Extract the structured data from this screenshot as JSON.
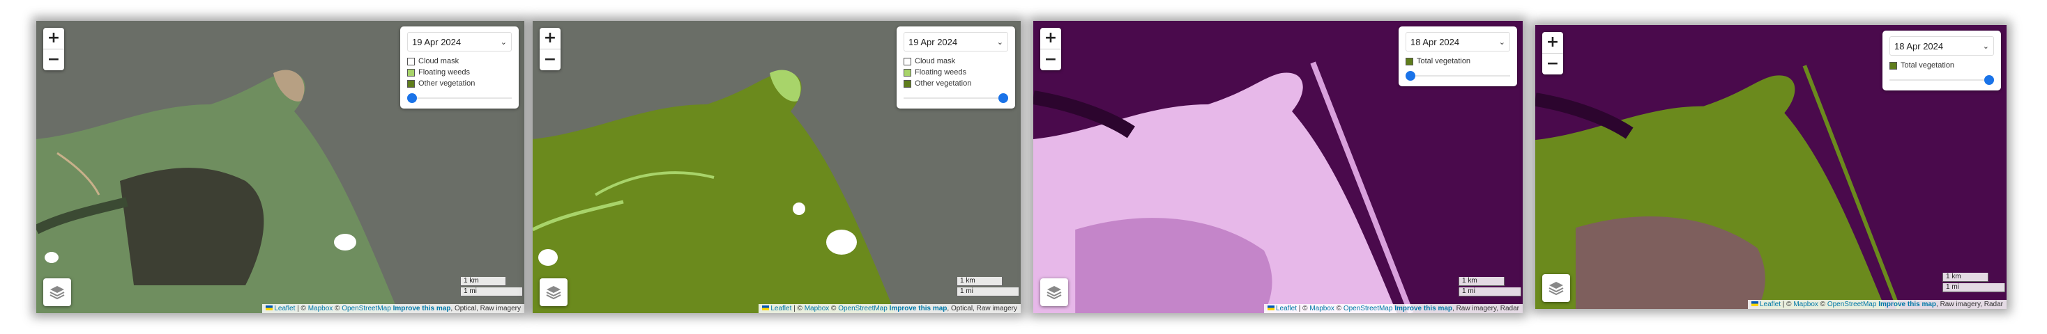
{
  "zoom": {
    "in_label": "+",
    "out_label": "−"
  },
  "attribution": {
    "leaflet": "Leaflet",
    "sep1": " | © ",
    "mapbox": "Mapbox",
    "sep2": " © ",
    "osm": "OpenStreetMap",
    "improve": "Improve this map"
  },
  "scale": {
    "km": "1 km",
    "mi": "1 mi"
  },
  "panels": [
    {
      "date": "19 Apr 2024",
      "slider_value": 0,
      "suffix": ", Optical, Raw imagery",
      "legend": [
        {
          "label": "Cloud mask",
          "color": "#ffffff"
        },
        {
          "label": "Floating weeds",
          "color": "#a8d46a"
        },
        {
          "label": "Other vegetation",
          "color": "#5f7d1c"
        }
      ]
    },
    {
      "date": "19 Apr 2024",
      "slider_value": 1,
      "suffix": ", Optical, Raw imagery",
      "legend": [
        {
          "label": "Cloud mask",
          "color": "#ffffff"
        },
        {
          "label": "Floating weeds",
          "color": "#a8d46a"
        },
        {
          "label": "Other vegetation",
          "color": "#5f7d1c"
        }
      ]
    },
    {
      "date": "18 Apr 2024",
      "slider_value": 0,
      "suffix": ", Raw imagery, Radar",
      "legend": [
        {
          "label": "Total vegetation",
          "color": "#5f7d1c"
        }
      ]
    },
    {
      "date": "18 Apr 2024",
      "slider_value": 1,
      "suffix": ", Raw imagery, Radar",
      "legend": [
        {
          "label": "Total vegetation",
          "color": "#5f7d1c"
        }
      ]
    }
  ],
  "colors": {
    "water_optical": "#6a6e67",
    "land_optical": "#6f8e5f",
    "veg": "#6b8a1d",
    "radar_bg": "#4a0a4c",
    "radar_land": "#e7b8e9",
    "link": "#0078a8"
  }
}
